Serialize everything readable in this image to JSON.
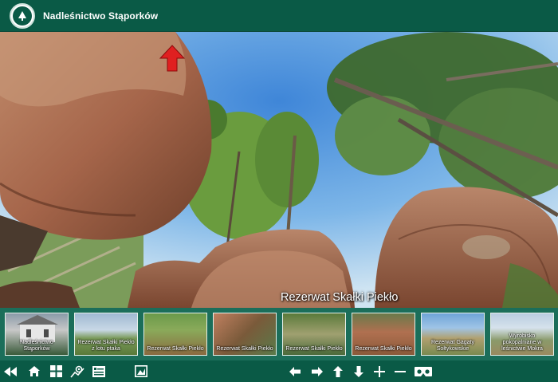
{
  "header": {
    "title": "Nadleśnictwo Stąporków"
  },
  "panorama": {
    "scene_title": "Rezerwat Skałki Piekło"
  },
  "thumbnails": [
    {
      "label": "Nadleśnictwo Stąporków",
      "palette": [
        "#6d7d8a",
        "#3a5a3a",
        "#c9c9c9"
      ]
    },
    {
      "label": "Rezerwat Skałki Piekło z lotu ptaka",
      "palette": [
        "#9fb9d2",
        "#6a8a4a",
        "#b8c8a0"
      ]
    },
    {
      "label": "Rezerwat Skałki Piekło",
      "palette": [
        "#5a7a3a",
        "#8a6a40",
        "#a0b070"
      ]
    },
    {
      "label": "Rezerwat Skałki Piekło",
      "palette": [
        "#7a5a3a",
        "#c08060",
        "#5a7a4a"
      ]
    },
    {
      "label": "Rezerwat Skałki Piekło",
      "palette": [
        "#6a8a5a",
        "#a0a070",
        "#4a6a3a"
      ]
    },
    {
      "label": "Rezerwat Skałki Piekło",
      "palette": [
        "#8a5a3a",
        "#b07050",
        "#5a6a3a"
      ]
    },
    {
      "label": "Rezerwat Gagaty Sołtykowskie",
      "palette": [
        "#8fb6da",
        "#b0a070",
        "#7a8a50"
      ]
    },
    {
      "label": "Wyrobisko pokopalniane w leśnictwie Mokra",
      "palette": [
        "#b8cce0",
        "#8a9a6a",
        "#9a8a60"
      ]
    }
  ],
  "toolbar": {
    "left": [
      "rewind-icon",
      "home-icon",
      "grid-icon",
      "map-pin-icon",
      "flag-icon",
      "image-icon"
    ],
    "nav": [
      "arrow-left-icon",
      "arrow-right-icon",
      "arrow-up-icon",
      "arrow-down-icon",
      "zoom-in-icon",
      "zoom-out-icon",
      "vr-goggles-icon"
    ]
  },
  "colors": {
    "header_bg": "#0a5a46",
    "strip_bg": "#1b6e5a",
    "hotspot": "#e02020"
  }
}
